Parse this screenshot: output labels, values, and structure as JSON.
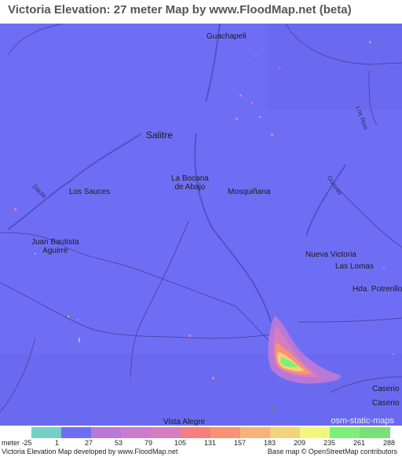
{
  "title": "Victoria Elevation: 27 meter Map by www.FloodMap.net (beta)",
  "map": {
    "base_color": "#6e6ef5",
    "places": [
      {
        "id": "guachapeli",
        "text": "Guachapeli",
        "cls": "place"
      },
      {
        "id": "salitre",
        "text": "Salitre",
        "cls": "place big"
      },
      {
        "id": "la-bocana",
        "text": "La Bocana\nde Abajo",
        "cls": "place center"
      },
      {
        "id": "los-sauces",
        "text": "Los Sauces",
        "cls": "place"
      },
      {
        "id": "mosquinana",
        "text": "Mosquiñana",
        "cls": "place"
      },
      {
        "id": "juan-bautista",
        "text": "Juan Bautista\nAguirre",
        "cls": "place center"
      },
      {
        "id": "nueva-victoria",
        "text": "Nueva Victoria",
        "cls": "place"
      },
      {
        "id": "las-lomas",
        "text": "Las Lomas",
        "cls": "place"
      },
      {
        "id": "hda-potrerillo",
        "text": "Hda. Potrerillo",
        "cls": "place"
      },
      {
        "id": "caserio-1",
        "text": "Caserio",
        "cls": "place"
      },
      {
        "id": "caserio-2",
        "text": "Caserio",
        "cls": "place"
      },
      {
        "id": "vista-alegre",
        "text": "Vista Alegre",
        "cls": "place"
      }
    ],
    "road_labels": [
      {
        "id": "los-rios",
        "text": "Los Rios"
      },
      {
        "id": "daule",
        "text": "Daule"
      },
      {
        "id": "guayas",
        "text": "Guayas"
      }
    ],
    "watermark": "osm-static-maps"
  },
  "legend": {
    "unit_label": "meter",
    "ticks": [
      "-25",
      "1",
      "27",
      "53",
      "79",
      "105",
      "131",
      "157",
      "183",
      "209",
      "235",
      "261",
      "288"
    ],
    "colors": [
      "#76cfc6",
      "#6e6ef5",
      "#b778d8",
      "#cc7cd0",
      "#d57dbf",
      "#f77d7f",
      "#f99373",
      "#f7b279",
      "#f2d27a",
      "#f2f67c",
      "#7bf07a",
      "#79df79"
    ]
  },
  "footer": {
    "left": "Victoria Elevation Map developed by www.FloodMap.net",
    "right": "Base map © OpenStreetMap contributors"
  }
}
